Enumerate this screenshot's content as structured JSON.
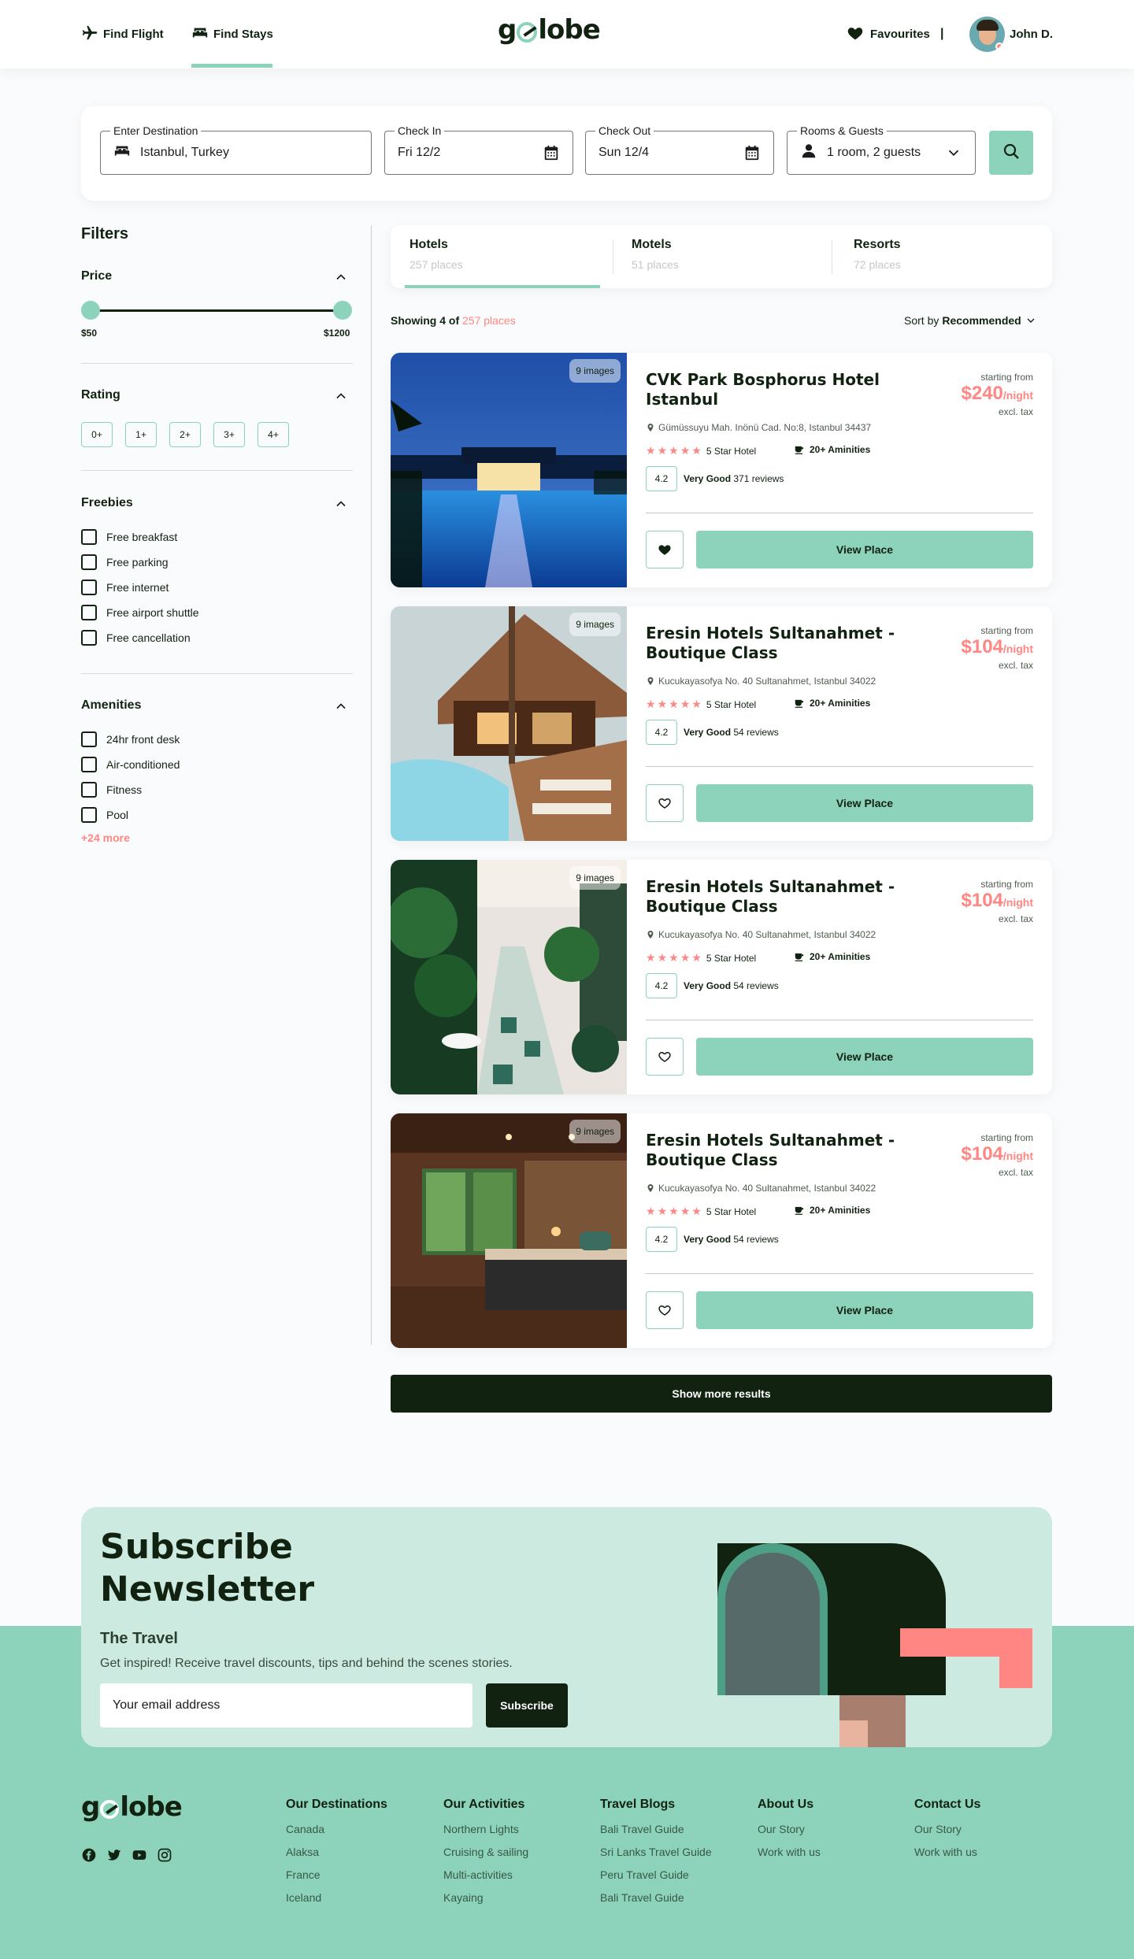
{
  "header": {
    "nav_flight": "Find Flight",
    "nav_stays": "Find Stays",
    "logo_left": "g",
    "logo_right": "lobe",
    "favourites": "Favourites",
    "divider": "|",
    "user_name": "John D."
  },
  "search": {
    "destination_label": "Enter Destination",
    "destination_value": "Istanbul, Turkey",
    "checkin_label": "Check In",
    "checkin_value": "Fri 12/2",
    "checkout_label": "Check Out",
    "checkout_value": "Sun 12/4",
    "rooms_label": "Rooms & Guests",
    "rooms_value": "1 room, 2 guests"
  },
  "filters": {
    "title": "Filters",
    "price_title": "Price",
    "price_min": "$50",
    "price_max": "$1200",
    "rating_title": "Rating",
    "ratings": [
      "0+",
      "1+",
      "2+",
      "3+",
      "4+"
    ],
    "freebies_title": "Freebies",
    "freebies": [
      "Free breakfast",
      "Free parking",
      "Free internet",
      "Free airport shuttle",
      "Free cancellation"
    ],
    "amenities_title": "Amenities",
    "amenities": [
      "24hr front desk",
      "Air-conditioned",
      "Fitness",
      "Pool"
    ],
    "amenities_more": "+24 more"
  },
  "tabs": [
    {
      "name": "Hotels",
      "count": "257 places"
    },
    {
      "name": "Motels",
      "count": "51 places"
    },
    {
      "name": "Resorts",
      "count": "72 places"
    }
  ],
  "results": {
    "showing_prefix": "Showing 4 of ",
    "showing_accent": "257 places",
    "sort_prefix": "Sort by ",
    "sort_value": "Recommended"
  },
  "hotels": [
    {
      "name": "CVK Park Bosphorus Hotel Istanbul",
      "images": "9 images",
      "address": "Gümüssuyu Mah. Inönü Cad. No:8, Istanbul 34437",
      "stars_label": "5 Star Hotel",
      "amenities": "20+ Aminities",
      "score": "4.2",
      "score_word": "Very Good",
      "reviews": "371 reviews",
      "from": "starting from",
      "price": "$240",
      "per": "/night",
      "tax": "excl. tax",
      "favourited": true,
      "button": "View Place"
    },
    {
      "name": "Eresin Hotels Sultanahmet - Boutique Class",
      "images": "9 images",
      "address": "Kucukayasofya No. 40 Sultanahmet, Istanbul 34022",
      "stars_label": "5 Star Hotel",
      "amenities": "20+ Aminities",
      "score": "4.2",
      "score_word": "Very Good",
      "reviews": "54 reviews",
      "from": "starting from",
      "price": "$104",
      "per": "/night",
      "tax": "excl. tax",
      "favourited": false,
      "button": "View Place"
    },
    {
      "name": "Eresin Hotels Sultanahmet - Boutique Class",
      "images": "9 images",
      "address": "Kucukayasofya No. 40 Sultanahmet, Istanbul 34022",
      "stars_label": "5 Star Hotel",
      "amenities": "20+ Aminities",
      "score": "4.2",
      "score_word": "Very Good",
      "reviews": "54 reviews",
      "from": "starting from",
      "price": "$104",
      "per": "/night",
      "tax": "excl. tax",
      "favourited": false,
      "button": "View Place"
    },
    {
      "name": "Eresin Hotels Sultanahmet - Boutique Class",
      "images": "9 images",
      "address": "Kucukayasofya No. 40 Sultanahmet, Istanbul 34022",
      "stars_label": "5 Star Hotel",
      "amenities": "20+ Aminities",
      "score": "4.2",
      "score_word": "Very Good",
      "reviews": "54 reviews",
      "from": "starting from",
      "price": "$104",
      "per": "/night",
      "tax": "excl. tax",
      "favourited": false,
      "button": "View Place"
    }
  ],
  "show_more": "Show more results",
  "newsletter": {
    "title_line1": "Subscribe",
    "title_line2": "Newsletter",
    "subtitle": "The Travel",
    "description": "Get inspired! Receive travel discounts, tips and behind the scenes stories.",
    "email_placeholder": "Your email address",
    "button": "Subscribe"
  },
  "footer": {
    "columns": [
      {
        "title": "Our Destinations",
        "links": [
          "Canada",
          "Alaksa",
          "France",
          "Iceland"
        ]
      },
      {
        "title": "Our Activities",
        "links": [
          "Northern Lights",
          "Cruising & sailing",
          "Multi-activities",
          "Kayaing"
        ]
      },
      {
        "title": "Travel Blogs",
        "links": [
          "Bali Travel Guide",
          "Sri Lanks Travel Guide",
          "Peru Travel Guide",
          "Bali Travel Guide"
        ]
      },
      {
        "title": "About Us",
        "links": [
          "Our Story",
          "Work with us"
        ]
      },
      {
        "title": "Contact Us",
        "links": [
          "Our Story",
          "Work with us"
        ]
      }
    ]
  },
  "colors": {
    "brand_mint": "#8dd3bb",
    "brand_dark": "#112211",
    "accent_salmon": "#ff8682",
    "newsletter_bg": "#cdeae1"
  },
  "icons": [
    "airplane-icon",
    "bed-icon",
    "heart-icon",
    "search-icon",
    "calendar-icon",
    "person-icon",
    "chevron-down-icon",
    "chevron-up-icon",
    "location-pin-icon",
    "cup-icon",
    "star-icon",
    "facebook-icon",
    "twitter-icon",
    "youtube-icon",
    "instagram-icon"
  ]
}
